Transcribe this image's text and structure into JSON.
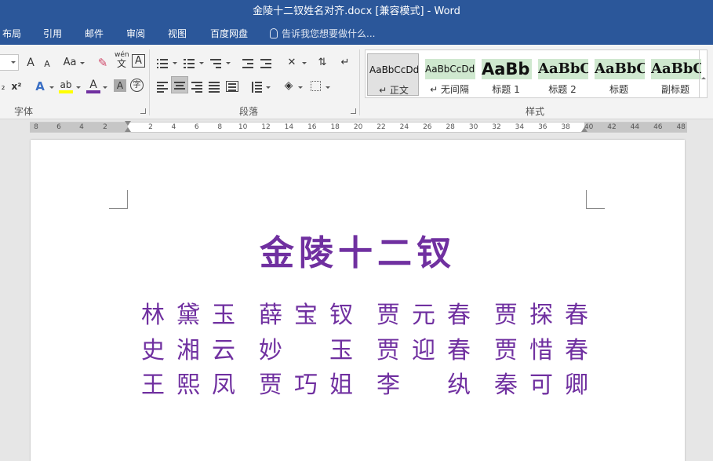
{
  "window": {
    "title": "金陵十二钗姓名对齐.docx [兼容模式] - Word"
  },
  "menu": {
    "tabs": [
      "布局",
      "引用",
      "邮件",
      "审阅",
      "视图",
      "百度网盘"
    ],
    "tell_me": "告诉我您想要做什么..."
  },
  "ribbon": {
    "font_group": {
      "label": "字体",
      "grow_font": "A",
      "shrink_font": "A",
      "change_case": "Aa",
      "phonetic": "wén",
      "phonetic_char": "文",
      "char_border": "A",
      "subscript": "₂",
      "superscript": "x²",
      "text_effect": "A",
      "highlight": "ab",
      "font_color": "A",
      "char_shading": "A",
      "enclose_char": "字"
    },
    "paragraph_group": {
      "label": "段落"
    },
    "styles_group": {
      "label": "样式",
      "items": [
        {
          "sample": "AaBbCcDd",
          "name": "↵ 正文",
          "selected": true
        },
        {
          "sample": "AaBbCcDd",
          "name": "↵ 无间隔",
          "selected": false
        },
        {
          "sample": "AaBb",
          "name": "标题 1",
          "selected": false
        },
        {
          "sample": "AaBbC",
          "name": "标题 2",
          "selected": false
        },
        {
          "sample": "AaBbC",
          "name": "标题",
          "selected": false
        },
        {
          "sample": "AaBbC",
          "name": "副标题",
          "selected": false
        }
      ]
    }
  },
  "ruler": {
    "left_labels": [
      "8",
      "6",
      "4",
      "2"
    ],
    "right_labels": [
      "2",
      "4",
      "6",
      "8",
      "10",
      "12",
      "14",
      "16",
      "18",
      "20",
      "22",
      "24",
      "26",
      "28",
      "30",
      "32",
      "34",
      "36",
      "38",
      "40",
      "42",
      "44",
      "46",
      "48"
    ]
  },
  "document": {
    "title": "金陵十二钗",
    "rows": [
      [
        "林黛玉",
        "薛宝钗",
        "贾元春",
        "贾探春"
      ],
      [
        "史湘云",
        "妙玉",
        "贾迎春",
        "贾惜春"
      ],
      [
        "王熙凤",
        "贾巧姐",
        "李纨",
        "秦可卿"
      ]
    ]
  },
  "colors": {
    "word_blue": "#2b579a",
    "title_purple": "#7030a0",
    "highlight_yellow": "#ffff00",
    "font_color_bar": "#7030a0",
    "style_sample_bg": "#cfe8cf"
  }
}
